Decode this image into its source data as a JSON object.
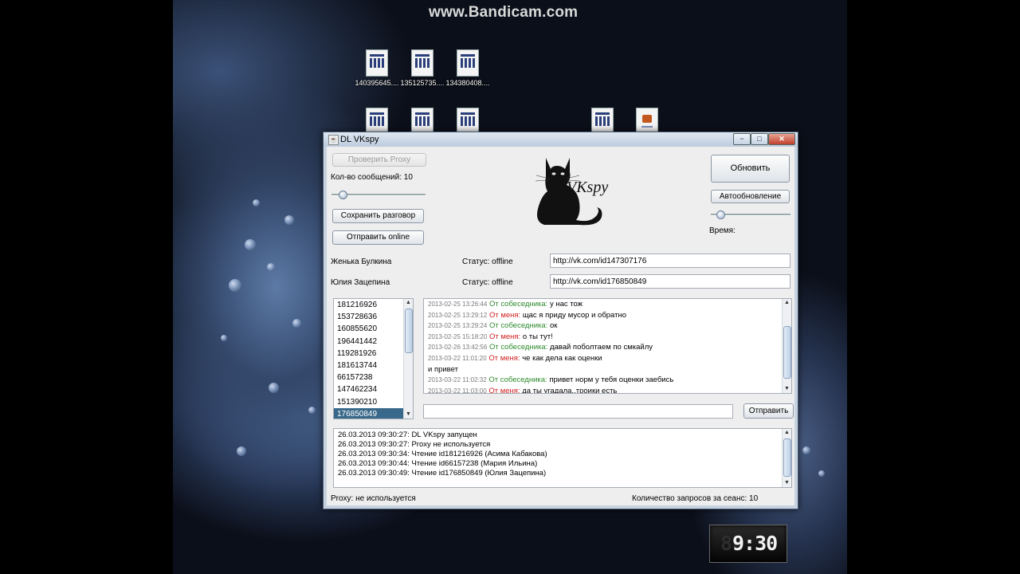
{
  "watermark": "www.Bandicam.com",
  "desktop_icons": [
    {
      "label": "140395645....",
      "kind": "doc"
    },
    {
      "label": "135125735....",
      "kind": "doc"
    },
    {
      "label": "134380408....",
      "kind": "doc"
    },
    {
      "label": "",
      "kind": "doc"
    },
    {
      "label": "",
      "kind": "doc"
    },
    {
      "label": "",
      "kind": "doc"
    },
    {
      "label": "",
      "kind": "doc"
    },
    {
      "label": "",
      "kind": "java"
    }
  ],
  "window": {
    "title": "DL VKspy",
    "title_icon": "java-icon",
    "controls": {
      "minimize": "−",
      "maximize": "□",
      "close": "✕"
    }
  },
  "toolbar": {
    "check_proxy": "Проверить Proxy",
    "msg_count_label": "Кол-во сообщений: 10",
    "msg_slider_fraction": 0.08,
    "save_conversation": "Сохранить разговор",
    "send_online": "Отправить online",
    "refresh": "Обновить",
    "auto_refresh": "Автообновление",
    "time_slider_fraction": 0.08,
    "time_label": "Время:"
  },
  "logo": {
    "text": "VKspy",
    "icon": "cat-logo"
  },
  "users": [
    {
      "name": "Женька Булкина",
      "status": "Статус: offline",
      "url": "http://vk.com/id147307176"
    },
    {
      "name": "Юлия Зацепина",
      "status": "Статус: offline",
      "url": "http://vk.com/id176850849"
    }
  ],
  "id_list": {
    "items": [
      "181216926",
      "153728636",
      "160855620",
      "196441442",
      "119281926",
      "181613744",
      "66157238",
      "147462234",
      "151390210",
      "176850849"
    ],
    "selected_index": 9
  },
  "chat": [
    {
      "ts": "2013-02-25 13:26:44",
      "who": "them",
      "sender": "От собеседника:",
      "text": "у нас тож"
    },
    {
      "ts": "2013-02-25 13:29:12",
      "who": "me",
      "sender": "От меня:",
      "text": "щас я приду мусор и обратно"
    },
    {
      "ts": "2013-02-25 13:29:24",
      "who": "them",
      "sender": "От собеседника:",
      "text": "ок"
    },
    {
      "ts": "2013-02-25 15:18:20",
      "who": "me",
      "sender": "От меня:",
      "text": "о ты тут!"
    },
    {
      "ts": "2013-02-26 13:42:56",
      "who": "them",
      "sender": "От собеседника:",
      "text": "давай поболтаем по смкайлу"
    },
    {
      "ts": "2013-03-22 11:01:20",
      "who": "me",
      "sender": "От меня:",
      "text": "че как дела как оценки"
    },
    {
      "ts": "",
      "who": "plain",
      "sender": "",
      "text": "и привет"
    },
    {
      "ts": "2013-03-22 11:02:32",
      "who": "them",
      "sender": "От собеседника:",
      "text": "привет норм у тебя оценки заебись"
    },
    {
      "ts": "2013-03-22 11:03:00",
      "who": "me",
      "sender": "От меня:",
      "text": "да ты угадала..троики есть"
    }
  ],
  "message_input": {
    "value": "",
    "send": "Отправить"
  },
  "log": [
    "26.03.2013 09:30:27: DL VKspy запущен",
    "26.03.2013 09:30:27: Proxy не используется",
    "26.03.2013 09:30:34: Чтение id181216926 (Асима Кабакова)",
    "26.03.2013 09:30:44: Чтение id66157238 (Мария Ильина)",
    "26.03.2013 09:30:49: Чтение id176850849 (Юлия Зацепина)"
  ],
  "statusbar": {
    "proxy": "Proxy: не используется",
    "requests": "Количество запросов за сеанс: 10"
  },
  "clock": {
    "time": "9:30",
    "ghost": "88"
  }
}
